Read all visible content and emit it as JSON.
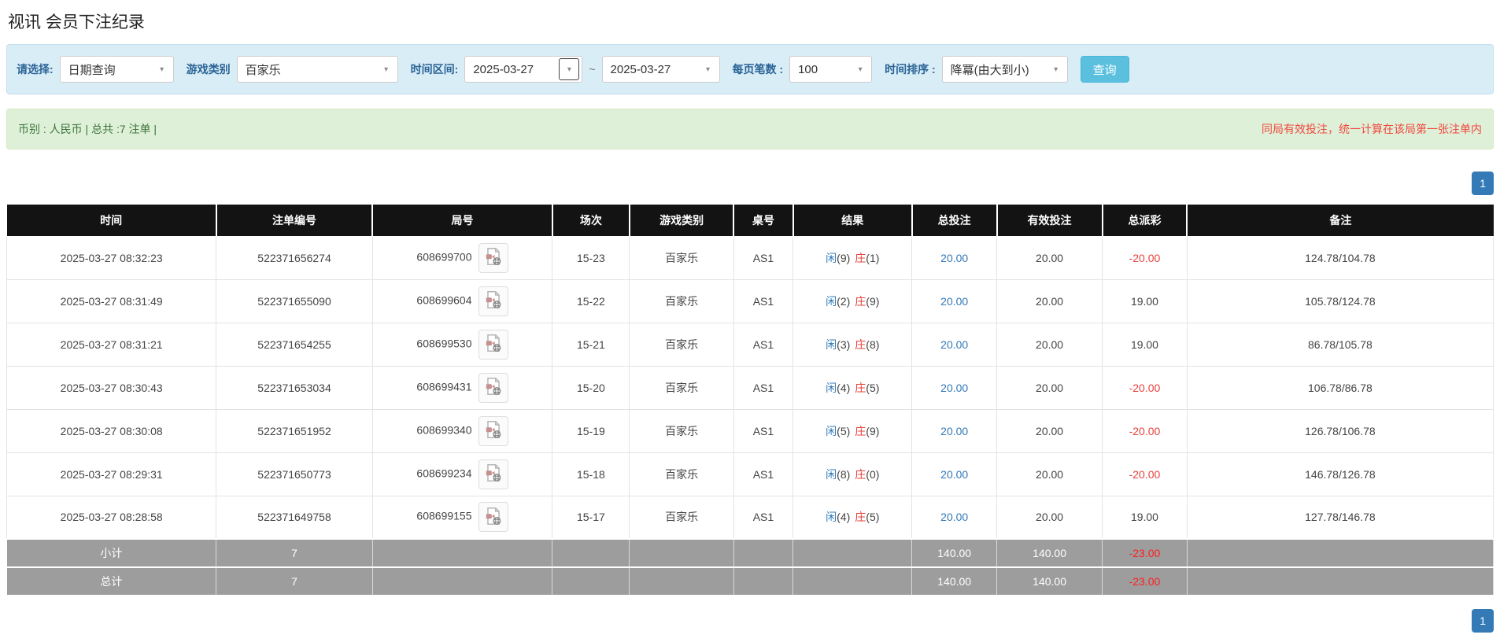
{
  "page": {
    "title": "视讯 会员下注纪录"
  },
  "icons": {
    "dropdown_arrow": "▾",
    "video_file": "video-file-icon"
  },
  "colors": {
    "filter_bar_bg": "#d9edf7",
    "filter_label_blue": "#2a6496",
    "search_button_bg": "#5bc0de",
    "info_bar_bg": "#dff0d8",
    "info_text_green": "#3c763d",
    "warning_text_red": "#f0483f",
    "table_header_bg": "#131313",
    "link_blue": "#337ab7",
    "negative_red": "#e8433c",
    "summary_row_bg": "#9d9d9d",
    "pagination_blue": "#337ab7"
  },
  "filters": {
    "query_type": {
      "label": "请选择:",
      "value": "日期查询"
    },
    "game_category": {
      "label": "游戏类别",
      "value": "百家乐"
    },
    "date_range": {
      "label": "时间区间:",
      "from": "2025-03-27",
      "separator": "~",
      "to": "2025-03-27"
    },
    "page_size": {
      "label": "每页笔数 :",
      "value": "100"
    },
    "time_sort": {
      "label": "时间排序 :",
      "value": "降冪(由大到小)"
    },
    "search_button": "查询"
  },
  "info_bar": {
    "left_text": "币别 : 人民币 | 总共 :7 注单 |",
    "right_note": "同局有效投注，统一计算在该局第一张注单内"
  },
  "pagination": {
    "top_page": "1",
    "bottom_page": "1"
  },
  "table": {
    "headers": {
      "time": "时间",
      "bet_id": "注单编号",
      "round_id": "局号",
      "session": "场次",
      "game": "游戏类别",
      "table_no": "桌号",
      "result": "结果",
      "total_bet": "总投注",
      "valid_bet": "有效投注",
      "payout": "总派彩",
      "remark": "备注"
    },
    "rows": [
      {
        "time": "2025-03-27 08:32:23",
        "bet_id": "522371656274",
        "round_id": "608699700",
        "session": "15-23",
        "game": "百家乐",
        "table_no": "AS1",
        "res_p_label": "闲",
        "res_p_val": "(9)",
        "res_b_label": "庄",
        "res_b_val": "(1)",
        "total_bet": "20.00",
        "valid_bet": "20.00",
        "payout": "-20.00",
        "remark": "124.78/104.78"
      },
      {
        "time": "2025-03-27 08:31:49",
        "bet_id": "522371655090",
        "round_id": "608699604",
        "session": "15-22",
        "game": "百家乐",
        "table_no": "AS1",
        "res_p_label": "闲",
        "res_p_val": "(2)",
        "res_b_label": "庄",
        "res_b_val": "(9)",
        "total_bet": "20.00",
        "valid_bet": "20.00",
        "payout": "19.00",
        "remark": "105.78/124.78"
      },
      {
        "time": "2025-03-27 08:31:21",
        "bet_id": "522371654255",
        "round_id": "608699530",
        "session": "15-21",
        "game": "百家乐",
        "table_no": "AS1",
        "res_p_label": "闲",
        "res_p_val": "(3)",
        "res_b_label": "庄",
        "res_b_val": "(8)",
        "total_bet": "20.00",
        "valid_bet": "20.00",
        "payout": "19.00",
        "remark": "86.78/105.78"
      },
      {
        "time": "2025-03-27 08:30:43",
        "bet_id": "522371653034",
        "round_id": "608699431",
        "session": "15-20",
        "game": "百家乐",
        "table_no": "AS1",
        "res_p_label": "闲",
        "res_p_val": "(4)",
        "res_b_label": "庄",
        "res_b_val": "(5)",
        "total_bet": "20.00",
        "valid_bet": "20.00",
        "payout": "-20.00",
        "remark": "106.78/86.78"
      },
      {
        "time": "2025-03-27 08:30:08",
        "bet_id": "522371651952",
        "round_id": "608699340",
        "session": "15-19",
        "game": "百家乐",
        "table_no": "AS1",
        "res_p_label": "闲",
        "res_p_val": "(5)",
        "res_b_label": "庄",
        "res_b_val": "(9)",
        "total_bet": "20.00",
        "valid_bet": "20.00",
        "payout": "-20.00",
        "remark": "126.78/106.78"
      },
      {
        "time": "2025-03-27 08:29:31",
        "bet_id": "522371650773",
        "round_id": "608699234",
        "session": "15-18",
        "game": "百家乐",
        "table_no": "AS1",
        "res_p_label": "闲",
        "res_p_val": "(8)",
        "res_b_label": "庄",
        "res_b_val": "(0)",
        "total_bet": "20.00",
        "valid_bet": "20.00",
        "payout": "-20.00",
        "remark": "146.78/126.78"
      },
      {
        "time": "2025-03-27 08:28:58",
        "bet_id": "522371649758",
        "round_id": "608699155",
        "session": "15-17",
        "game": "百家乐",
        "table_no": "AS1",
        "res_p_label": "闲",
        "res_p_val": "(4)",
        "res_b_label": "庄",
        "res_b_val": "(5)",
        "total_bet": "20.00",
        "valid_bet": "20.00",
        "payout": "19.00",
        "remark": "127.78/146.78"
      }
    ],
    "subtotal": {
      "label": "小计",
      "count": "7",
      "total_bet": "140.00",
      "valid_bet": "140.00",
      "payout": "-23.00"
    },
    "total": {
      "label": "总计",
      "count": "7",
      "total_bet": "140.00",
      "valid_bet": "140.00",
      "payout": "-23.00"
    }
  }
}
